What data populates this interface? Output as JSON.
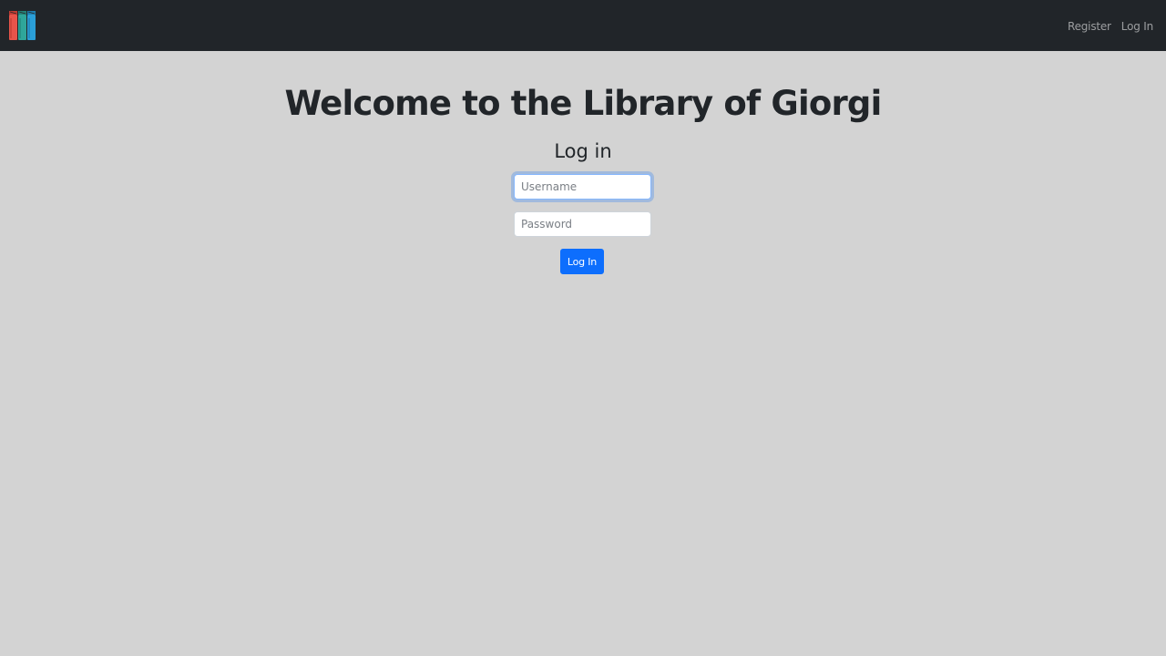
{
  "navbar": {
    "logo_icon": "books-logo-icon",
    "links": [
      {
        "label": "Register"
      },
      {
        "label": "Log In"
      }
    ]
  },
  "main": {
    "title": "Welcome to the Library of Giorgi",
    "subtitle": "Log in",
    "username": {
      "placeholder": "Username",
      "value": ""
    },
    "password": {
      "placeholder": "Password",
      "value": ""
    },
    "submit_label": "Log In"
  },
  "colors": {
    "navbar_bg": "#212529",
    "page_bg": "#d3d3d3",
    "primary": "#0d6efd",
    "logo_red": "#e8544a",
    "logo_teal": "#2fa69a",
    "logo_blue": "#2a9fd8"
  }
}
